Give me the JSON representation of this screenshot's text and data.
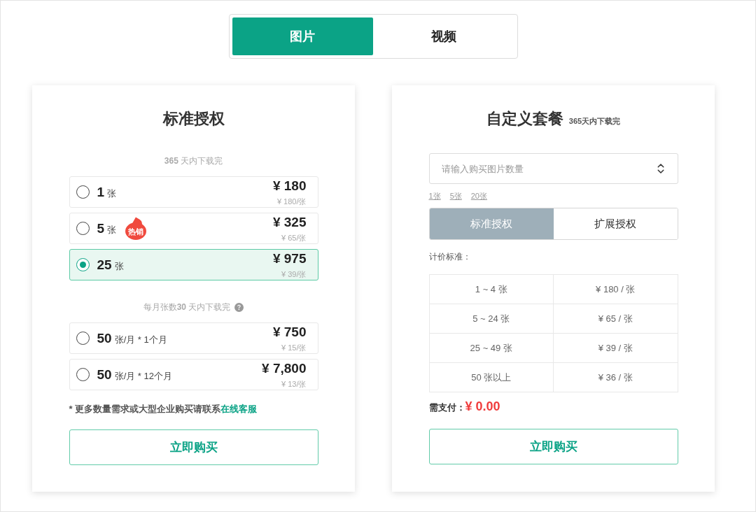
{
  "media_tabs": [
    {
      "label": "图片",
      "selected": true
    },
    {
      "label": "视频",
      "selected": false
    }
  ],
  "standard_plan": {
    "title": "标准授权",
    "groups": [
      {
        "note": "**365** 天内下载完",
        "options": [
          {
            "count": "1",
            "unit": "张",
            "price": "¥ 180",
            "unit_price": "¥ 180/张",
            "selected": false
          },
          {
            "count": "5",
            "unit": "张",
            "badge": "热销",
            "price": "¥ 325",
            "unit_price": "¥ 65/张",
            "selected": false
          },
          {
            "count": "25",
            "unit": "张",
            "price": "¥ 975",
            "unit_price": "¥ 39/张",
            "selected": true
          }
        ]
      },
      {
        "note": "每月张数**30** 天内下载完",
        "help_icon": true,
        "options": [
          {
            "count": "50",
            "unit": "张/月 * 1个月",
            "price": "¥ 750",
            "unit_price": "¥ 15/张",
            "selected": false
          },
          {
            "count": "50",
            "unit": "张/月 * 12个月",
            "price": "¥ 7,800",
            "unit_price": "¥ 13/张",
            "selected": false
          }
        ]
      }
    ],
    "footnote": {
      "text": "* 更多数量需求或大型企业购买请联系",
      "link": "在线客服"
    },
    "buy_button": "立即购买"
  },
  "custom_plan": {
    "title": "自定义套餐",
    "title_note": "365天内下载完",
    "quantity_field": {
      "placeholder": "请输入购买图片数量"
    },
    "quick_picks": [
      "1张",
      "5张",
      "20张"
    ],
    "license_tabs": [
      {
        "label": "标准授权",
        "selected": true
      },
      {
        "label": "扩展授权",
        "selected": false
      }
    ],
    "pricing_label": "计价标准：",
    "pricing_table": {
      "rows": [
        {
          "quantity": "1 ~ 4 张",
          "unit_price": "¥ 180 / 张"
        },
        {
          "quantity": "5 ~ 24 张",
          "unit_price": "¥ 65 / 张"
        },
        {
          "quantity": "25 ~ 49 张",
          "unit_price": "¥ 39 / 张"
        },
        {
          "quantity": "50 张以上",
          "unit_price": "¥ 36 / 张"
        }
      ]
    },
    "total_label": "需支付：",
    "total": "¥ 0.00",
    "buy_button": "立即购买"
  }
}
